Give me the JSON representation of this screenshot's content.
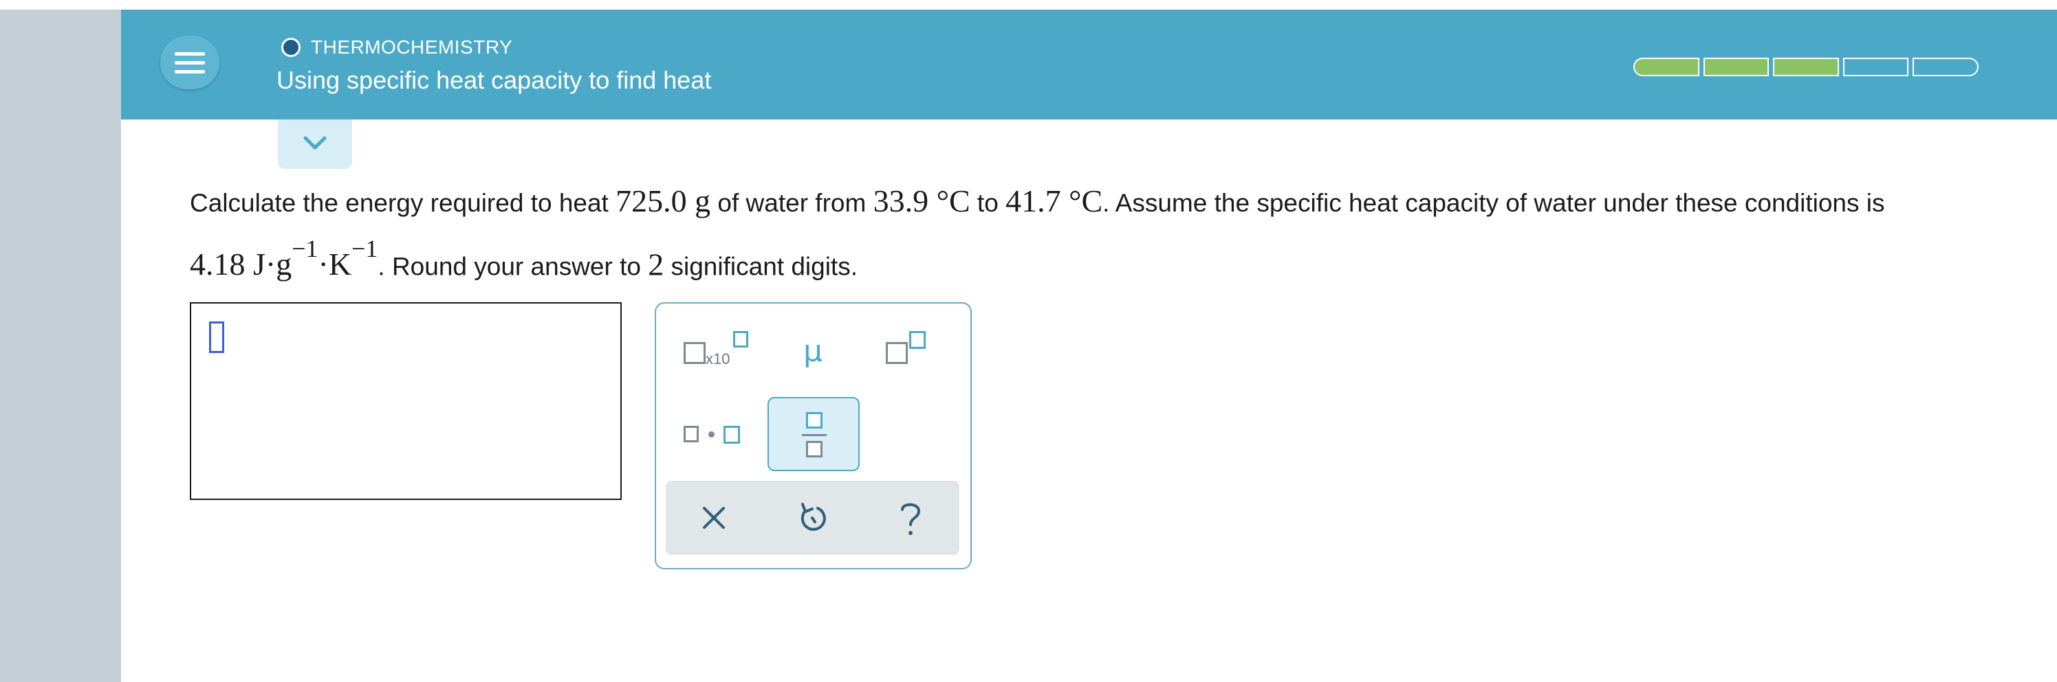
{
  "header": {
    "topic": "THERMOCHEMISTRY",
    "title": "Using specific heat capacity to find heat",
    "progress": {
      "completed": 3,
      "total": 5
    }
  },
  "question": {
    "part1": "Calculate the energy required to heat ",
    "mass": "725.0 g",
    "part2": " of water from ",
    "t1": "33.9 °C",
    "part3": " to ",
    "t2": "41.7 °C",
    "part4": ". Assume the specific heat capacity of water under these conditions is",
    "cap_value": "4.18 J·g",
    "exp1": "−1",
    "cap_unit": "·K",
    "exp2": "−1",
    "part5": ". Round your answer to ",
    "sigfigs": "2",
    "part6": " significant digits."
  },
  "palette": {
    "x10_label": "x10",
    "mu_label": "μ",
    "clear_label": "×",
    "help_label": "?"
  },
  "colors": {
    "header": "#4ba9c7",
    "progress_done": "#8cc164",
    "rail": "#c5d0d6",
    "palette_border": "#6fa9c2",
    "caret": "#3d5fd9"
  }
}
